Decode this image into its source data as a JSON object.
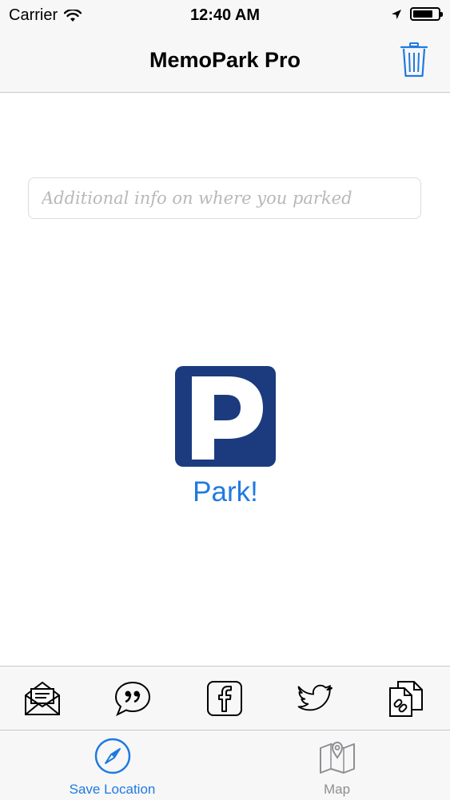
{
  "status_bar": {
    "carrier": "Carrier",
    "time": "12:40 AM",
    "icons": [
      "wifi-icon",
      "location-arrow-icon",
      "battery-icon"
    ]
  },
  "nav_bar": {
    "title": "MemoPark Pro",
    "trash_icon": "trash-icon"
  },
  "info_input": {
    "placeholder": "Additional info on where you parked",
    "value": ""
  },
  "park": {
    "sign_letter": "P",
    "label": "Park!"
  },
  "share_bar": {
    "buttons": [
      "mail-icon",
      "message-icon",
      "facebook-icon",
      "twitter-icon",
      "copy-link-icon"
    ]
  },
  "tab_bar": {
    "tabs": [
      {
        "label": "Save Location",
        "icon": "compass-icon",
        "selected": true
      },
      {
        "label": "Map",
        "icon": "map-pin-icon",
        "selected": false
      }
    ]
  },
  "colors": {
    "accent": "#1f7ae0",
    "sign_blue": "#1b3b7e",
    "inactive_tab": "#8e8e93",
    "bar_background": "#f7f7f7"
  }
}
